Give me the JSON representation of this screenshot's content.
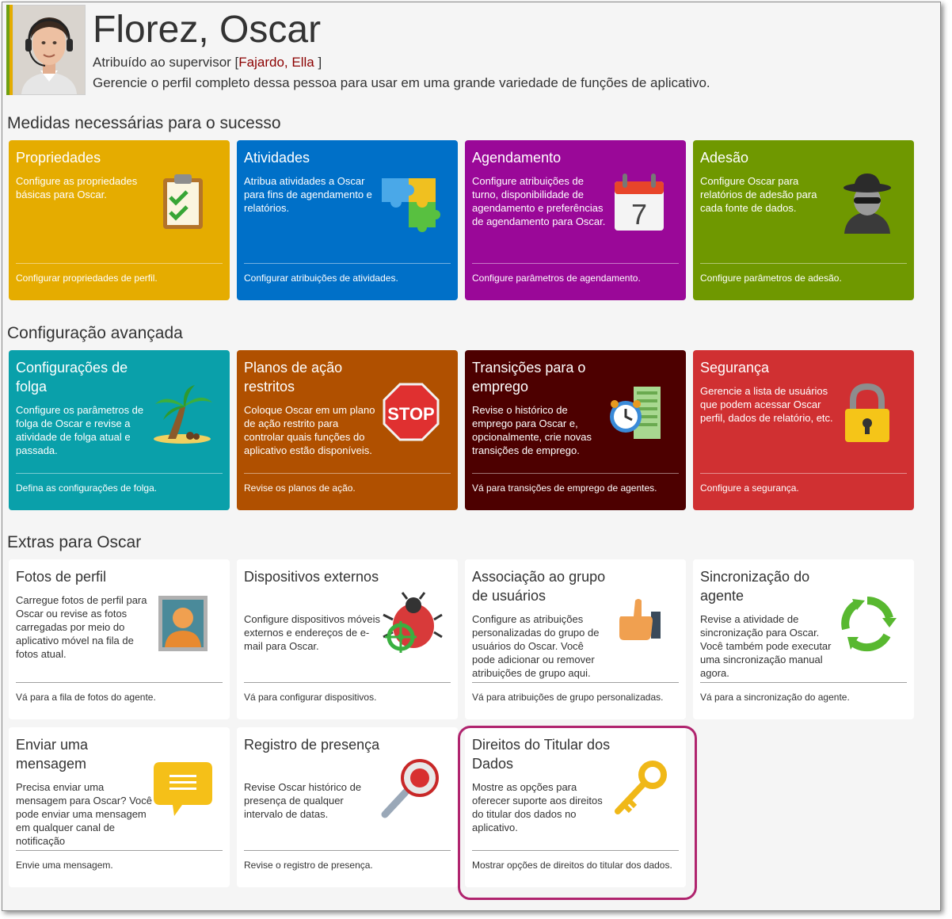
{
  "header": {
    "name": "Florez, Oscar",
    "supervisor_prefix": "Atribuído ao supervisor ",
    "supervisor_open": "[",
    "supervisor_name": "Fajardo, Ella",
    "supervisor_close": " ]",
    "subtitle": "Gerencie o perfil completo dessa pessoa para usar em uma grande variedade de funções de aplicativo."
  },
  "sections": [
    {
      "title": "Medidas necessárias para o sucesso",
      "tiles": [
        {
          "title": "Propriedades",
          "desc": "Configure as propriedades básicas para Oscar.",
          "link": "Configurar propriedades de perfil.",
          "icon": "clipboard-checklist-icon",
          "color": "#e5ac00"
        },
        {
          "title": "Atividades",
          "desc": "Atribua atividades a Oscar para fins de agendamento e relatórios.",
          "link": "Configurar atribuições de atividades.",
          "icon": "puzzle-icon",
          "color": "#0070c8"
        },
        {
          "title": "Agendamento",
          "desc": "Configure atribuições de turno, disponibilidade de agendamento e preferências de agendamento para Oscar.",
          "link": "Configure parâmetros de agendamento.",
          "icon": "calendar-icon",
          "color": "#9a0898"
        },
        {
          "title": "Adesão",
          "desc": "Configure Oscar para relatórios de adesão para cada fonte de dados.",
          "link": "Configure parâmetros de adesão.",
          "icon": "spy-icon",
          "color": "#6f9800"
        }
      ]
    },
    {
      "title": "Configuração avançada",
      "tiles": [
        {
          "title": "Configurações de folga",
          "desc": "Configure os parâmetros de folga de Oscar e revise a atividade de folga atual e passada.",
          "link": "Defina as configurações de folga.",
          "icon": "palm-tree-icon",
          "color": "#0aa0aa"
        },
        {
          "title": "Planos de ação restritos",
          "desc": "Coloque Oscar em um plano de ação restrito para controlar quais funções do aplicativo estão disponíveis.",
          "link": "Revise os planos de ação.",
          "icon": "stop-sign-icon",
          "color": "#b05000"
        },
        {
          "title": "Transições para o emprego",
          "desc": "Revise o histórico de emprego para Oscar e, opcionalmente, crie novas transições de emprego.",
          "link": "Vá para transições de emprego de agentes.",
          "icon": "clock-document-icon",
          "color": "#4d0000"
        },
        {
          "title": "Segurança",
          "desc": "Gerencie a lista de usuários que podem acessar Oscar perfil, dados de relatório, etc.",
          "link": "Configure a segurança.",
          "icon": "padlock-icon",
          "color": "#d03032"
        }
      ]
    },
    {
      "title": "Extras para Oscar",
      "tiles": [
        {
          "title": "Fotos de perfil",
          "desc": "Carregue fotos de perfil para Oscar ou revise as fotos carregadas por meio do aplicativo móvel na fila de fotos atual.",
          "link": "Vá para a fila de fotos do agente.",
          "icon": "profile-photo-icon"
        },
        {
          "title": "Dispositivos externos",
          "desc": "Configure dispositivos móveis externos e endereços de e-mail para Oscar.",
          "link": "Vá para configurar dispositivos.",
          "icon": "bug-target-icon"
        },
        {
          "title": "Associação ao grupo de usuários",
          "desc": "Configure as atribuições personalizadas do grupo de usuários do Oscar. Você pode adicionar ou remover atribuições de grupo aqui.",
          "link": "Vá para atribuições de grupo personalizadas.",
          "icon": "thumbs-up-icon"
        },
        {
          "title": "Sincronização do agente",
          "desc": "Revise a atividade de sincronização para Oscar. Você também pode executar uma sincronização manual agora.",
          "link": "Vá para a sincronização do agente.",
          "icon": "sync-arrows-icon"
        },
        {
          "title": "Enviar uma mensagem",
          "desc": "Precisa enviar uma mensagem para Oscar? Você pode enviar uma mensagem em qualquer canal de notificação",
          "link": "Envie uma mensagem.",
          "icon": "message-bubble-icon"
        },
        {
          "title": "Registro de presença",
          "desc": "Revise Oscar histórico de presença de qualquer intervalo de datas.",
          "link": "Revise o registro de presença.",
          "icon": "magnifier-icon"
        },
        {
          "title": "Direitos do Titular dos Dados",
          "desc": "Mostre as opções para oferecer suporte aos direitos do titular dos dados no aplicativo.",
          "link": "Mostrar opções de direitos do titular dos dados.",
          "icon": "key-icon"
        }
      ]
    }
  ]
}
